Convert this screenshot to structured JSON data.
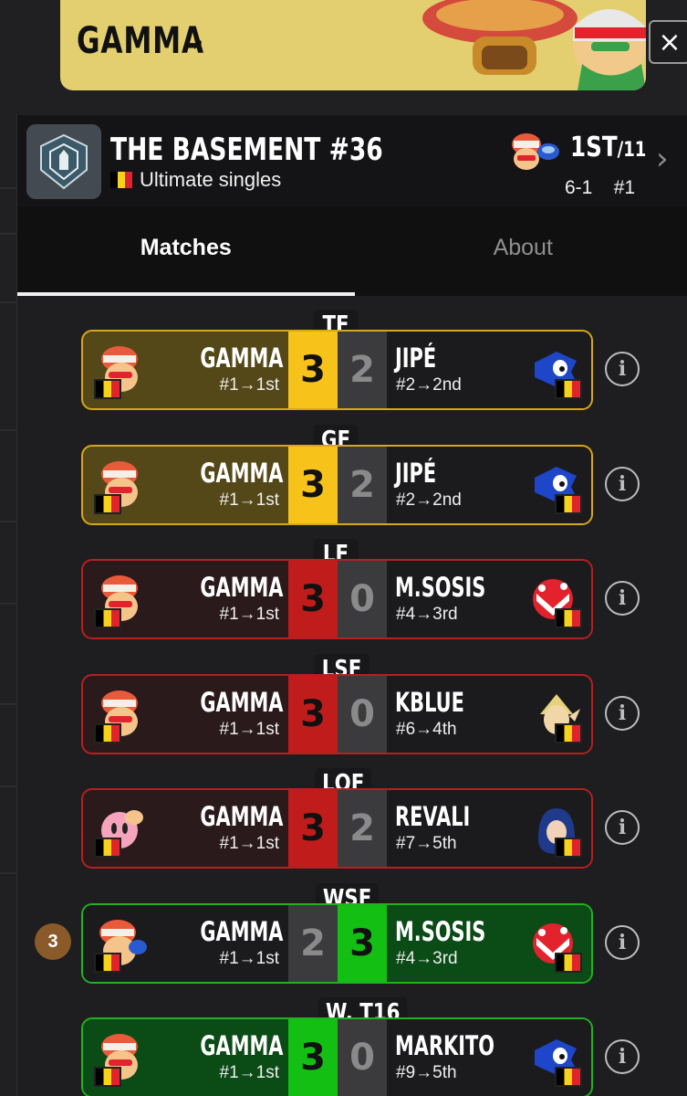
{
  "banner": {
    "title": "GAMMA",
    "chevron": "›"
  },
  "close_icon": "×",
  "event": {
    "title": "THE BASEMENT #36",
    "subtitle": "Ultimate singles",
    "placement_main": "1ST",
    "placement_total": "/11",
    "record": "6-1",
    "seed": "#1"
  },
  "tabs": [
    {
      "label": "Matches",
      "active": true
    },
    {
      "label": "About",
      "active": false
    }
  ],
  "matches": [
    {
      "round": "TF",
      "left": {
        "name": "GAMMA",
        "seed": "#1→1st",
        "score": "3"
      },
      "right": {
        "name": "JIPÉ",
        "seed": "#2→2nd",
        "score": "2"
      }
    },
    {
      "round": "GF",
      "left": {
        "name": "GAMMA",
        "seed": "#1→1st",
        "score": "3"
      },
      "right": {
        "name": "JIPÉ",
        "seed": "#2→2nd",
        "score": "2"
      }
    },
    {
      "round": "LF",
      "left": {
        "name": "GAMMA",
        "seed": "#1→1st",
        "score": "3"
      },
      "right": {
        "name": "M.SOSIS",
        "seed": "#4→3rd",
        "score": "0"
      }
    },
    {
      "round": "LSF",
      "left": {
        "name": "GAMMA",
        "seed": "#1→1st",
        "score": "3"
      },
      "right": {
        "name": "KBLUE",
        "seed": "#6→4th",
        "score": "0"
      }
    },
    {
      "round": "LQF",
      "left": {
        "name": "GAMMA",
        "seed": "#1→1st",
        "score": "3"
      },
      "right": {
        "name": "REVALI",
        "seed": "#7→5th",
        "score": "2"
      }
    },
    {
      "round": "WSF",
      "left": {
        "name": "GAMMA",
        "seed": "#1→1st",
        "score": "2"
      },
      "right": {
        "name": "M.SOSIS",
        "seed": "#4→3rd",
        "score": "3"
      },
      "badge": "3"
    },
    {
      "round": "W. T16",
      "left": {
        "name": "GAMMA",
        "seed": "#1→1st",
        "score": "3"
      },
      "right": {
        "name": "MARKITO",
        "seed": "#9→5th",
        "score": "0"
      }
    }
  ],
  "info_label": "i",
  "colors": {
    "win_yellow": "#f7c21a",
    "win_red": "#c11c1c",
    "win_green": "#14bf14",
    "loss_grey": "#3b3b3d"
  }
}
